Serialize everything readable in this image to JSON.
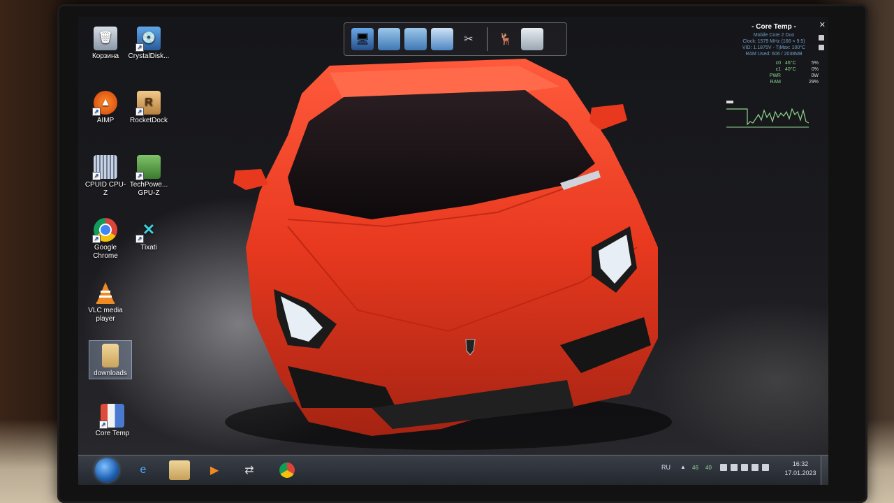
{
  "desktop": {
    "icons": [
      {
        "label": "Корзина",
        "icon": "recycle-bin-icon"
      },
      {
        "label": "CrystalDisk...",
        "icon": "crystaldisk-icon"
      },
      {
        "label": "AIMP",
        "icon": "aimp-icon"
      },
      {
        "label": "RocketDock",
        "icon": "rocketdock-icon",
        "glyph": "R"
      },
      {
        "label": "CPUID CPU-Z",
        "icon": "cpuz-icon"
      },
      {
        "label": "TechPowe... GPU-Z",
        "icon": "gpuz-icon"
      },
      {
        "label": "Google Chrome",
        "icon": "chrome-icon"
      },
      {
        "label": "Tixati",
        "icon": "tixati-icon"
      },
      {
        "label": "VLC media player",
        "icon": "vlc-icon"
      },
      {
        "label": "downloads",
        "icon": "folder-icon"
      },
      {
        "label": "Core Temp",
        "icon": "coretemp-icon"
      }
    ]
  },
  "dock": {
    "items": [
      "computer-icon",
      "folder-icon",
      "folder-icon",
      "pictures-icon",
      "tools-icon",
      "deer-icon",
      "recycle-bin-icon"
    ]
  },
  "core_temp": {
    "title": "- Core Temp -",
    "line1": "Mobile Core 2 Duo",
    "line2": "Clock: 1579 MHz (166 × 9.5)",
    "line3": "VID: 1.1875V - TjMax: 100°C",
    "line4": "RAM Used: 606 / 2038MB",
    "rows": [
      {
        "label": "c0",
        "value": "46°C",
        "pct": "5%"
      },
      {
        "label": "c1",
        "value": "40°C",
        "pct": "0%"
      },
      {
        "label": "PWR",
        "value": "",
        "pct": "0W"
      },
      {
        "label": "RAM",
        "value": "",
        "pct": "29%"
      }
    ]
  },
  "taskbar": {
    "pinned": [
      "ie-icon",
      "explorer-icon",
      "media-player-icon",
      "network-icon",
      "chrome-icon"
    ],
    "tray": {
      "lang": "RU",
      "arrow": "▲",
      "temp1": "46",
      "temp2": "40",
      "time": "16:32",
      "date": "17.01.2023"
    }
  },
  "colors": {
    "car": "#e8391f",
    "accent_green": "#8fd58f"
  }
}
